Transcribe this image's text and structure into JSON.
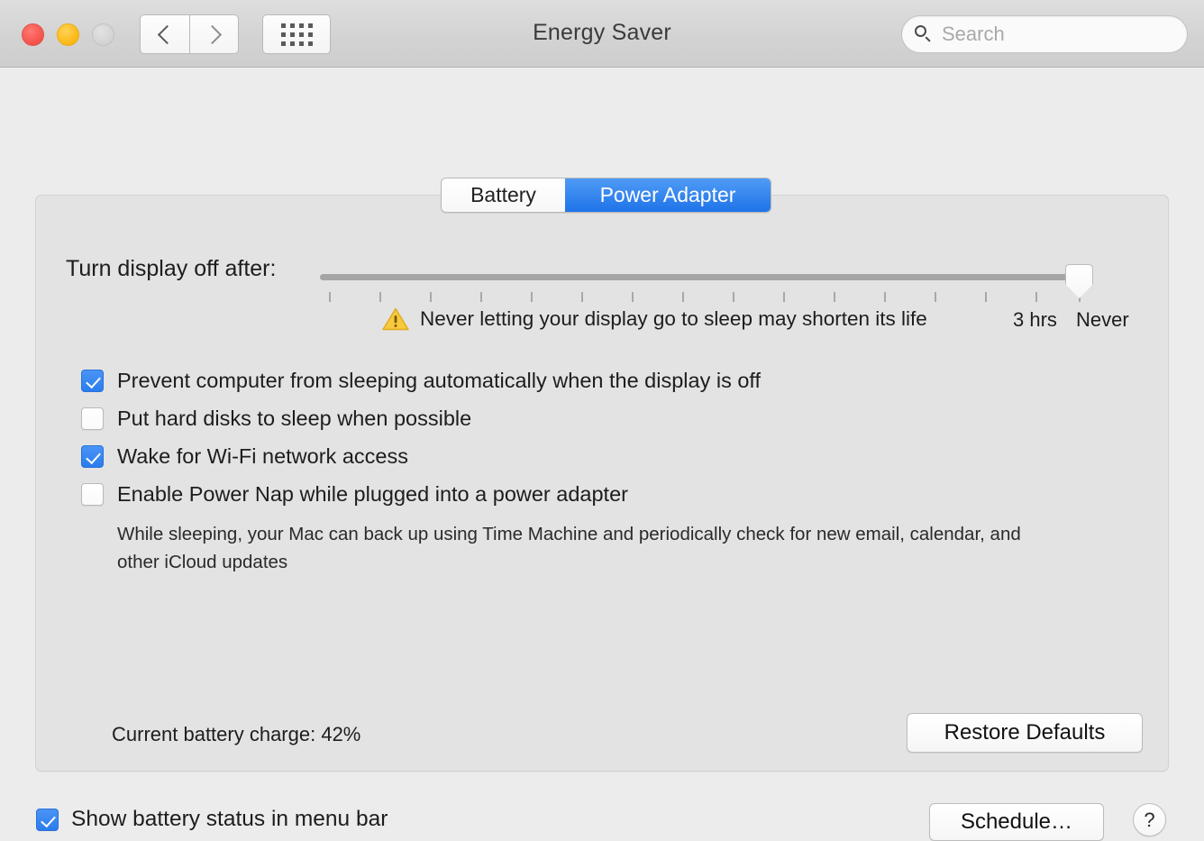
{
  "window": {
    "title": "Energy Saver",
    "traffic_lights": [
      "close",
      "minimize",
      "zoom"
    ]
  },
  "toolbar": {
    "back_icon": "chevron-left-icon",
    "forward_icon": "chevron-right-icon",
    "show_all_icon": "grid-icon",
    "search": {
      "placeholder": "Search",
      "value": "",
      "icon": "search-icon"
    }
  },
  "tabs": [
    {
      "label": "Battery",
      "selected": false
    },
    {
      "label": "Power Adapter",
      "selected": true
    }
  ],
  "slider": {
    "label": "Turn display off after:",
    "value": "Never",
    "tick_count": 16,
    "legend_left": "3 hrs",
    "legend_right": "Never"
  },
  "warning": {
    "icon": "warning-triangle-icon",
    "text": "Never letting your display go to sleep may shorten its life"
  },
  "options": [
    {
      "label": "Prevent computer from sleeping automatically when the display is off",
      "checked": true
    },
    {
      "label": "Put hard disks to sleep when possible",
      "checked": false
    },
    {
      "label": "Wake for Wi-Fi network access",
      "checked": true
    },
    {
      "label": "Enable Power Nap while plugged into a power adapter",
      "checked": false,
      "description": "While sleeping, your Mac can back up using Time Machine and periodically check for new email, calendar, and other iCloud updates"
    }
  ],
  "status": {
    "battery_charge": "Current battery charge: 42%"
  },
  "buttons": {
    "restore_defaults": "Restore Defaults",
    "schedule": "Schedule…",
    "help": "?"
  },
  "footer": {
    "show_battery_status": {
      "label": "Show battery status in menu bar",
      "checked": true
    }
  },
  "colors": {
    "accent": "#1f73e8",
    "checkbox_on": "#2a7cee",
    "warning": "#f5c518",
    "window_bg": "#ececec",
    "panel_bg": "#e3e3e3"
  }
}
